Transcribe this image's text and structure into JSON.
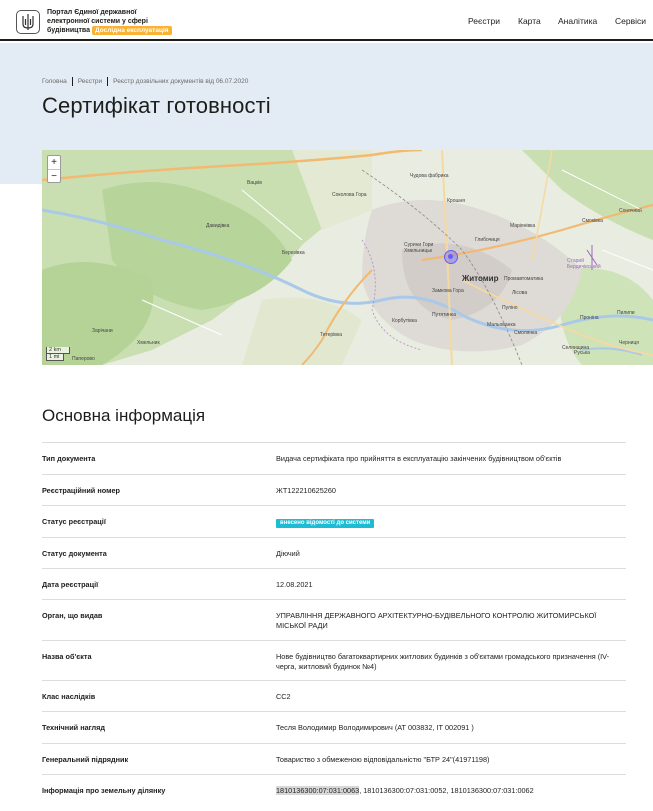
{
  "header": {
    "portal_line1": "Портал Єдиної державної",
    "portal_line2": "електронної системи у сфері",
    "portal_line3": "будівництва",
    "beta_badge": "Дослідна експлуатація",
    "nav": [
      "Реєстри",
      "Карта",
      "Аналітика",
      "Сервіси"
    ]
  },
  "breadcrumb": [
    "Головна",
    "Реєстри",
    "Реєстр дозвільних документів від 06.07.2020"
  ],
  "page_title": "Сертифікат готовності",
  "map": {
    "zoom_in": "+",
    "zoom_out": "−",
    "scale_km": "2 km",
    "scale_mi": "1 mi",
    "city": "Житомир",
    "labels": [
      "Соколова Гора",
      "Крошня",
      "Чудова фабрика",
      "Смоківка",
      "Сурини Гори Хмельницьк",
      "Глибочиця",
      "Маріянівка",
      "Давидівка",
      "Березівка",
      "Замкова Гора",
      "Промавтоматика",
      "Пуліно",
      "Корбутівка",
      "Лісова",
      "Путятинка",
      "Смолянка",
      "Тетерівка",
      "Мальованка",
      "Черниця",
      "Вацків",
      "Селянщина",
      "Старий Бердичівський",
      "Хмельник",
      "Паперово",
      "Руська",
      "Проніна",
      "Пилипи",
      "Сонячний",
      "Зарічани"
    ]
  },
  "section_title": "Основна інформація",
  "info": [
    {
      "key": "Тип документа",
      "value": "Видача сертифіката про прийняття в експлуатацію закінчених будівництвом об'єктів"
    },
    {
      "key": "Реєстраційний номер",
      "value": "ЖТ122210625260"
    },
    {
      "key": "Статус реєстрації",
      "value": "внесено відомості до системи"
    },
    {
      "key": "Статус документа",
      "value": "Діючий"
    },
    {
      "key": "Дата реєстрації",
      "value": "12.08.2021"
    },
    {
      "key": "Орган, що видав",
      "value": "УПРАВЛІННЯ ДЕРЖАВНОГО АРХІТЕКТУРНО-БУДІВЕЛЬНОГО КОНТРОЛЮ ЖИТОМИРСЬКОЇ МІСЬКОЇ РАДИ"
    },
    {
      "key": "Назва об'єкта",
      "value": "Нове будівництво багатоквартирних житлових будинків з об'єктами громадського призначення (IV-черга, житловий будинок №4)"
    },
    {
      "key": "Клас наслідків",
      "value": "СС2"
    },
    {
      "key": "Технічний нагляд",
      "value": "Тесля Володимир Володимирович (АТ 003832, ІТ 002091 )"
    },
    {
      "key": "Генеральний підрядник",
      "value": "Товариство з обмеженою відповідальністю \"БТР 24\"(41971198)"
    },
    {
      "key": "Інформація про земельну ділянку",
      "value_highlight": "1810136300:07:031:0063",
      "value_rest": ", 1810136300:07:031:0052, 1810136300:07:031:0062"
    }
  ]
}
